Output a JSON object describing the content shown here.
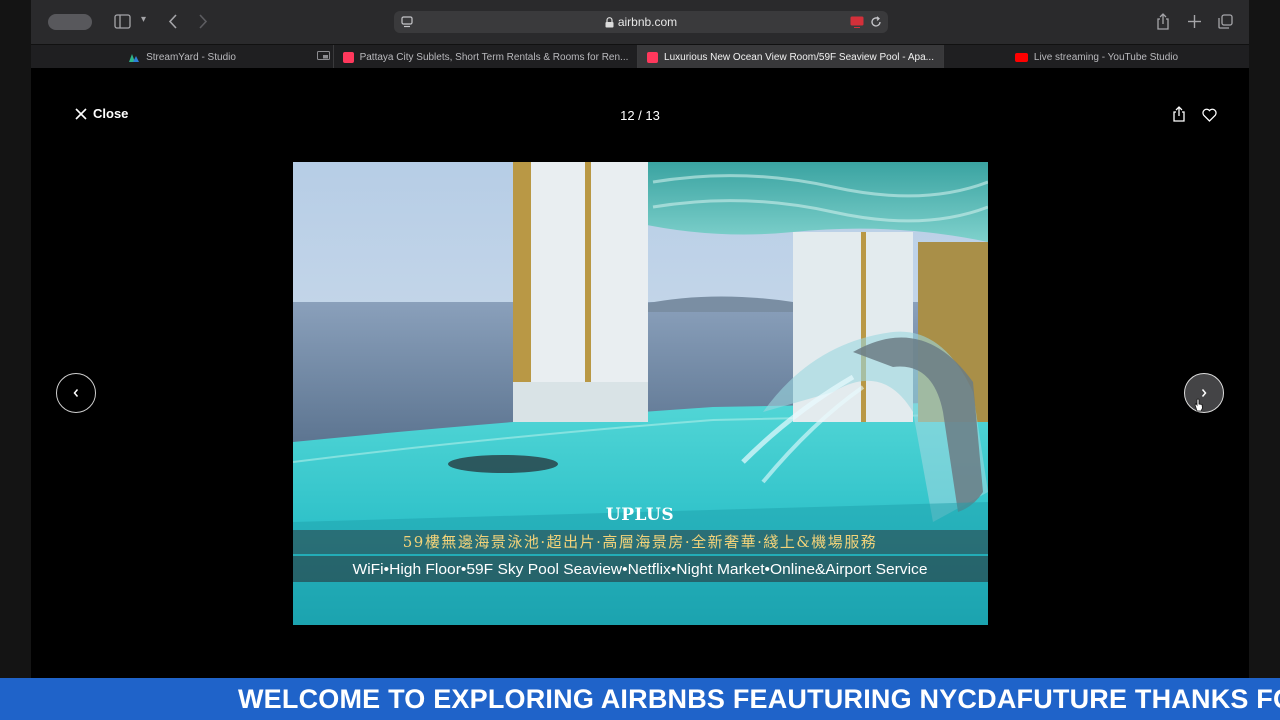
{
  "browser": {
    "url": "airbnb.com",
    "tabs": [
      {
        "label": "StreamYard - Studio",
        "active": false
      },
      {
        "label": "Pattaya City Sublets, Short Term Rentals & Rooms for Ren...",
        "active": false
      },
      {
        "label": "Luxurious New Ocean View Room/59F Seaview Pool - Apa...",
        "active": true
      },
      {
        "label": "Live streaming - YouTube Studio",
        "active": false
      }
    ]
  },
  "gallery": {
    "close_label": "Close",
    "counter": "12 / 13",
    "photo": {
      "brand": "UPLUS",
      "caption_zh": "59樓無邊海景泳池·超出片·高層海景房·全新奢華·綫上&機場服務",
      "caption_en": "WiFi•High Floor•59F Sky Pool Seaview•Netflix•Night Market•Online&Airport Service"
    }
  },
  "ticker": {
    "text": "WELCOME TO EXPLORING AIRBNBS FEAUTURING NYCDAFUTURE THANKS FOR TU"
  },
  "colors": {
    "ticker_bg": "#1f63c9",
    "airbnb_brand": "#ff385c",
    "youtube_red": "#ff0000"
  }
}
